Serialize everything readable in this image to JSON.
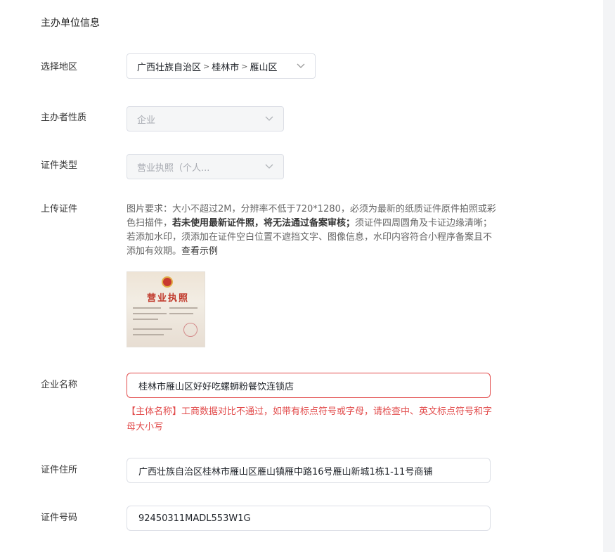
{
  "section_title": "主办单位信息",
  "region": {
    "label": "选择地区",
    "province": "广西壮族自治区",
    "city": "桂林市",
    "district": "雁山区",
    "separator": ">"
  },
  "sponsor_type": {
    "label": "主办者性质",
    "value": "企业"
  },
  "cert_type": {
    "label": "证件类型",
    "value": "营业执照（个人..."
  },
  "upload": {
    "label": "上传证件",
    "req_part1": "图片要求：大小不超过2M，分辨率不低于720*1280，必须为最新的纸质证件原件拍照或彩色扫描件，",
    "req_bold": "若未使用最新证件照，将无法通过备案审核；",
    "req_part2": "须证件四周圆角及卡证边缘清晰；若添加水印，须添加在证件空白位置不遮挡文字、图像信息，水印内容符合小程序备案且不添加有效期。",
    "example_link": "查看示例",
    "thumb_title": "营业执照"
  },
  "company_name": {
    "label": "企业名称",
    "value": "桂林市雁山区好好吃螺蛳粉餐饮连锁店",
    "error": "【主体名称】工商数据对比不通过，如带有标点符号或字母，请检查中、英文标点符号和字母大小写"
  },
  "address": {
    "label": "证件住所",
    "value": "广西壮族自治区桂林市雁山区雁山镇雁中路16号雁山新城1栋1-11号商铺"
  },
  "cert_number": {
    "label": "证件号码",
    "value": "92450311MADL553W1G"
  }
}
